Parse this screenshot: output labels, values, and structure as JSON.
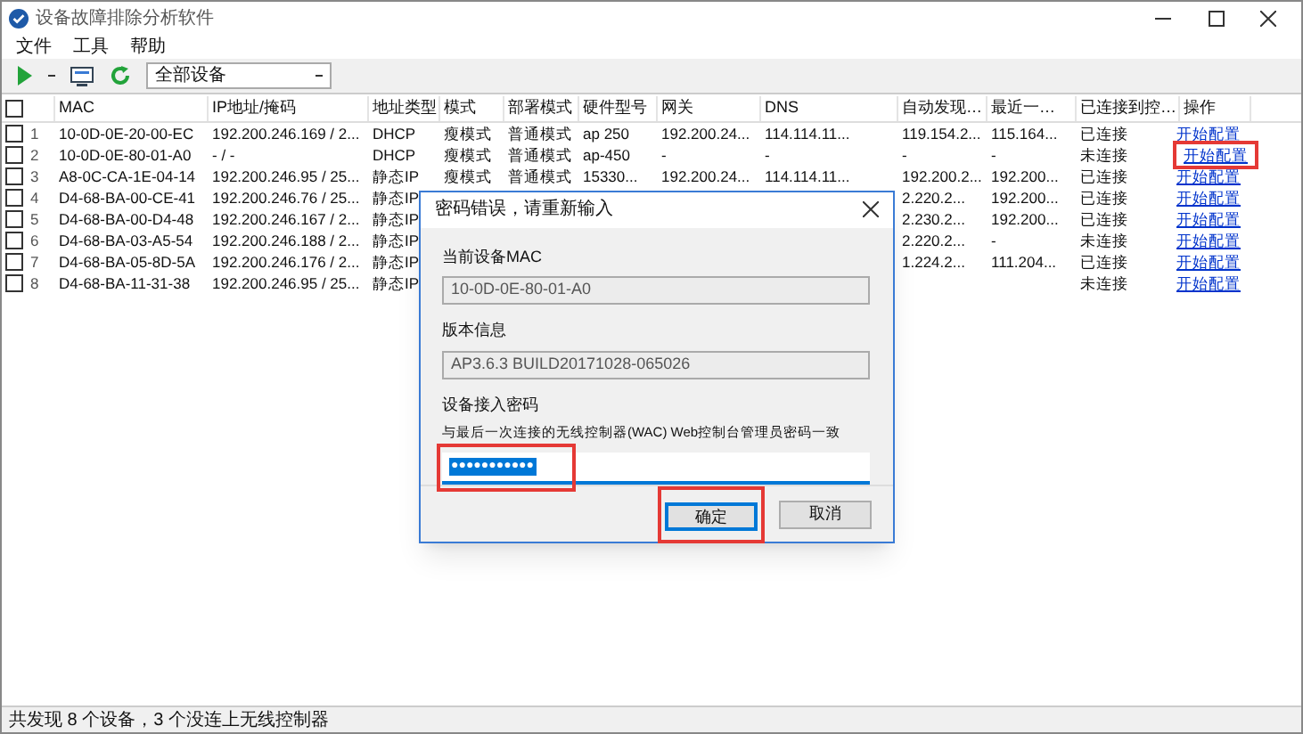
{
  "window": {
    "title": "设备故障排除分析软件"
  },
  "menu": [
    "文件",
    "工具",
    "帮助"
  ],
  "toolbar": {
    "filter": "全部设备"
  },
  "table": {
    "select_all": {
      "checked": false
    },
    "columns": [
      "MAC",
      "IP地址/掩码",
      "地址类型",
      "模式",
      "部署模式",
      "硬件型号",
      "网关",
      "DNS",
      "自动发现…",
      "最近一…",
      "已连接到控…",
      "操作"
    ],
    "rows": [
      {
        "checked": false,
        "index": "1",
        "mac": "10-0D-0E-20-00-EC",
        "ip": "192.200.246.169 / 2...",
        "address_type": "DHCP",
        "mode": "瘦模式",
        "deploy_mode": "普通模式",
        "model": "ap 250",
        "gateway": "192.200.24...",
        "dns": "114.114.11...",
        "auto_discover": "119.154.2...",
        "recent": "115.164...",
        "connection": "已连接",
        "action": {
          "label": "开始配置",
          "highlighted": false
        }
      },
      {
        "checked": false,
        "index": "2",
        "mac": "10-0D-0E-80-01-A0",
        "ip": "- / -",
        "address_type": "DHCP",
        "mode": "瘦模式",
        "deploy_mode": "普通模式",
        "model": "ap-450",
        "gateway": "-",
        "dns": "-",
        "auto_discover": "-",
        "recent": "-",
        "connection": "未连接",
        "action": {
          "label": "开始配置",
          "highlighted": true
        }
      },
      {
        "checked": false,
        "index": "3",
        "mac": "A8-0C-CA-1E-04-14",
        "ip": "192.200.246.95 / 25...",
        "address_type": "静态IP",
        "mode": "瘦模式",
        "deploy_mode": "普通模式",
        "model": "15330...",
        "gateway": "192.200.24...",
        "dns": "114.114.11...",
        "auto_discover": "192.200.2...",
        "recent": "192.200...",
        "connection": "已连接",
        "action": {
          "label": "开始配置",
          "highlighted": false
        }
      },
      {
        "checked": false,
        "index": "4",
        "mac": "D4-68-BA-00-CE-41",
        "ip": "192.200.246.76 / 25...",
        "address_type": "静态IP",
        "auto_discover": "2.220.2...",
        "recent": "192.200...",
        "connection": "已连接",
        "action": {
          "label": "开始配置",
          "highlighted": false
        }
      },
      {
        "checked": false,
        "index": "5",
        "mac": "D4-68-BA-00-D4-48",
        "ip": "192.200.246.167 / 2...",
        "address_type": "静态IP",
        "auto_discover": "2.230.2...",
        "recent": "192.200...",
        "connection": "已连接",
        "action": {
          "label": "开始配置",
          "highlighted": false
        }
      },
      {
        "checked": false,
        "index": "6",
        "mac": "D4-68-BA-03-A5-54",
        "ip": "192.200.246.188 / 2...",
        "address_type": "静态IP",
        "auto_discover": "2.220.2...",
        "recent": "-",
        "connection": "未连接",
        "action": {
          "label": "开始配置",
          "highlighted": false
        }
      },
      {
        "checked": false,
        "index": "7",
        "mac": "D4-68-BA-05-8D-5A",
        "ip": "192.200.246.176 / 2...",
        "address_type": "静态IP",
        "auto_discover": "1.224.2...",
        "recent": "111.204...",
        "connection": "已连接",
        "action": {
          "label": "开始配置",
          "highlighted": false
        }
      },
      {
        "checked": false,
        "index": "8",
        "mac": "D4-68-BA-11-31-38",
        "ip": "192.200.246.95 / 25...",
        "address_type": "静态IP",
        "connection": "未连接",
        "action": {
          "label": "开始配置",
          "highlighted": false
        }
      }
    ]
  },
  "dialog": {
    "title": "密码错误，请重新输入",
    "mac_label": "当前设备MAC",
    "mac_value": "10-0D-0E-80-01-A0",
    "version_label": "版本信息",
    "version_value": "AP3.6.3 BUILD20171028-065026",
    "password_label": "设备接入密码",
    "password_hint": "与最后一次连接的无线控制器(WAC) Web控制台管理员密码一致",
    "password_value": "●●●●●●●●●●●",
    "password_highlighted": true,
    "ok": {
      "label": "确定",
      "highlighted": true
    },
    "cancel": "取消"
  },
  "status_bar": "共发现 8 个设备，3 个没连上无线控制器"
}
